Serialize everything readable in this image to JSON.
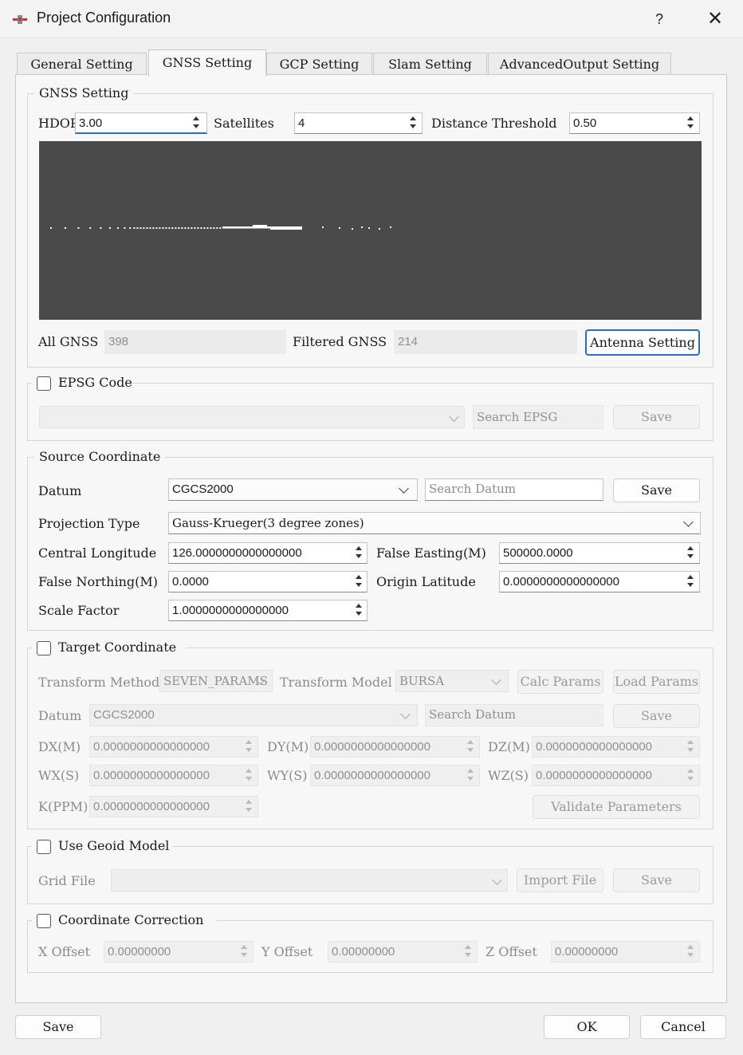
{
  "window": {
    "title": "Project Configuration",
    "help": "?",
    "close": "✕"
  },
  "tabs": [
    {
      "label": "General Setting"
    },
    {
      "label": "GNSS Setting"
    },
    {
      "label": "GCP Setting"
    },
    {
      "label": "Slam Setting"
    },
    {
      "label": "AdvancedOutput Setting"
    }
  ],
  "gnss": {
    "group_title": "GNSS Setting",
    "hdop_label": "HDOP",
    "hdop_value": "3.00",
    "satellites_label": "Satellites",
    "satellites_value": "4",
    "distance_label": "Distance Threshold",
    "distance_value": "0.50",
    "all_label": "All GNSS",
    "all_value": "398",
    "filtered_label": "Filtered GNSS",
    "filtered_value": "214",
    "antenna_button": "Antenna Setting"
  },
  "epsg": {
    "title": "EPSG Code",
    "search_placeholder": "Search EPSG",
    "save": "Save"
  },
  "source": {
    "title": "Source Coordinate",
    "datum_label": "Datum",
    "datum_value": "CGCS2000",
    "search_datum_placeholder": "Search Datum",
    "save": "Save",
    "projection_label": "Projection Type",
    "projection_value": "Gauss-Krueger(3 degree zones)",
    "central_longitude_label": "Central Longitude",
    "central_longitude_value": "126.0000000000000000",
    "false_easting_label": "False Easting(M)",
    "false_easting_value": "500000.0000",
    "false_northing_label": "False Northing(M)",
    "false_northing_value": "0.0000",
    "origin_latitude_label": "Origin Latitude",
    "origin_latitude_value": "0.0000000000000000",
    "scale_factor_label": "Scale Factor",
    "scale_factor_value": "1.0000000000000000"
  },
  "target": {
    "title": "Target Coordinate",
    "transform_method_label": "Transform Method",
    "transform_method_value": "SEVEN_PARAMS",
    "transform_model_label": "Transform Model",
    "transform_model_value": "BURSA",
    "calc_params": "Calc Params",
    "load_params": "Load Params",
    "datum_label": "Datum",
    "datum_value": "CGCS2000",
    "search_datum_placeholder": "Search Datum",
    "save": "Save",
    "dx_label": "DX(M)",
    "dx_value": "0.0000000000000000",
    "dy_label": "DY(M)",
    "dy_value": "0.0000000000000000",
    "dz_label": "DZ(M)",
    "dz_value": "0.0000000000000000",
    "wx_label": "WX(S)",
    "wx_value": "0.0000000000000000",
    "wy_label": "WY(S)",
    "wy_value": "0.0000000000000000",
    "wz_label": "WZ(S)",
    "wz_value": "0.0000000000000000",
    "k_label": "K(PPM)",
    "k_value": "0.0000000000000000",
    "validate": "Validate Parameters"
  },
  "geoid": {
    "title": "Use Geoid Model",
    "grid_label": "Grid File",
    "import": "Import File",
    "save": "Save"
  },
  "correction": {
    "title": "Coordinate Correction",
    "x_label": "X Offset",
    "x_value": "0.00000000",
    "y_label": "Y Offset",
    "y_value": "0.00000000",
    "z_label": "Z Offset",
    "z_value": "0.00000000"
  },
  "footer": {
    "save": "Save",
    "ok": "OK",
    "cancel": "Cancel"
  },
  "colors": {
    "accent": "#2a6cc4",
    "plot_bg": "#4a4a4a",
    "plot_points": "#ffffff"
  }
}
